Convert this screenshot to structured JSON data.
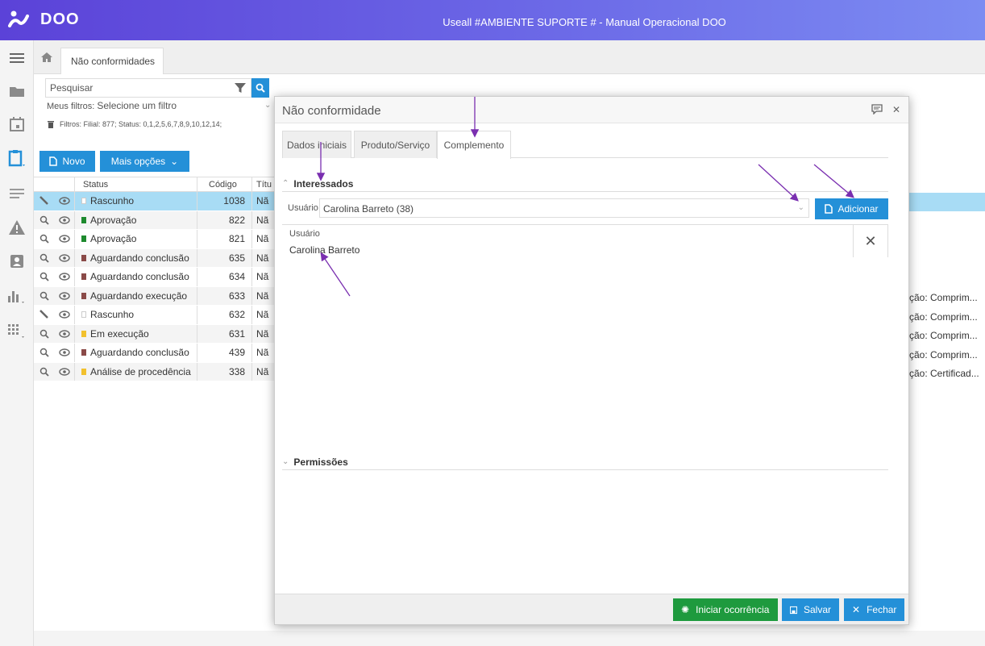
{
  "header": {
    "brand": "DOO",
    "title": "Useall #AMBIENTE SUPORTE # - Manual Operacional DOO"
  },
  "page_tab": {
    "label": "Não conformidades"
  },
  "search": {
    "placeholder": "Pesquisar"
  },
  "filters": {
    "my_filters_label": "Meus filtros:",
    "my_filters_value": "Selecione um filtro",
    "active_filters": "Filtros: Filial: 877; Status: 0,1,2,5,6,7,8,9,10,12,14;"
  },
  "toolbar": {
    "new_label": "Novo",
    "more_label": "Mais opções"
  },
  "table": {
    "headers": {
      "status": "Status",
      "code": "Código",
      "title": "Títu"
    },
    "rows": [
      {
        "status": "Rascunho",
        "code": "1038",
        "title": "Nã",
        "color": "#ffffff",
        "edit": true,
        "right": ""
      },
      {
        "status": "Aprovação",
        "code": "822",
        "title": "Nã",
        "color": "#1e8a2e",
        "edit": false,
        "right": ""
      },
      {
        "status": "Aprovação",
        "code": "821",
        "title": "Nã",
        "color": "#1e8a2e",
        "edit": false,
        "right": ""
      },
      {
        "status": "Aguardando conclusão",
        "code": "635",
        "title": "Nã",
        "color": "#8a4a48",
        "edit": false,
        "right": ""
      },
      {
        "status": "Aguardando conclusão",
        "code": "634",
        "title": "Nã",
        "color": "#8a4a48",
        "edit": false,
        "right": ""
      },
      {
        "status": "Aguardando execução",
        "code": "633",
        "title": "Nã",
        "color": "#8a4a48",
        "edit": false,
        "right": "ção: Comprim..."
      },
      {
        "status": "Rascunho",
        "code": "632",
        "title": "Nã",
        "color": "#ffffff",
        "edit": true,
        "right": "ção: Comprim..."
      },
      {
        "status": "Em execução",
        "code": "631",
        "title": "Nã",
        "color": "#f2c12e",
        "edit": false,
        "right": "ção: Comprim..."
      },
      {
        "status": "Aguardando conclusão",
        "code": "439",
        "title": "Nã",
        "color": "#8a4a48",
        "edit": false,
        "right": "ção: Comprim..."
      },
      {
        "status": "Análise de procedência",
        "code": "338",
        "title": "Nã",
        "color": "#f2c12e",
        "edit": false,
        "right": "ção: Certificad..."
      }
    ]
  },
  "modal": {
    "title": "Não conformidade",
    "tabs": [
      "Dados iniciais",
      "Produto/Serviço",
      "Complemento"
    ],
    "active_tab": "Complemento",
    "section_interessados": "Interessados",
    "user_label": "Usuário",
    "user_value": "Carolina Barreto (38)",
    "add_button": "Adicionar",
    "grid_header": "Usuário",
    "grid_value": "Carolina Barreto",
    "section_permissoes": "Permissões",
    "footer": {
      "start": "Iniciar ocorrência",
      "save": "Salvar",
      "close": "Fechar"
    }
  },
  "colors": {
    "accent": "#2490d8",
    "success": "#1e9a3e",
    "annotation": "#7a2fb0"
  }
}
